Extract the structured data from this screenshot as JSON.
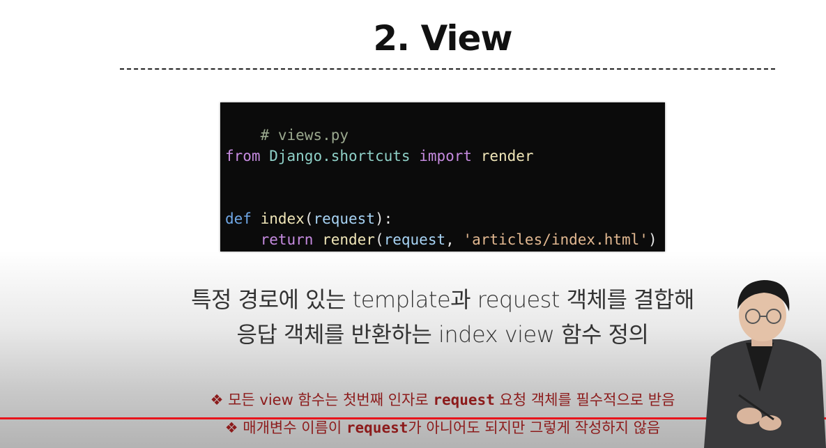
{
  "slide": {
    "title": "2. View",
    "code": {
      "comment": "# views.py",
      "line2": {
        "kw_from": "from",
        "module": "Django.shortcuts",
        "kw_import": "import",
        "name": "render"
      },
      "line5": {
        "kw_def": "def",
        "fn": "index",
        "open": "(",
        "param": "request",
        "close": "):"
      },
      "line6": {
        "kw_return": "return",
        "fn": "render",
        "open": "(",
        "param": "request",
        "sep": ", ",
        "str": "'articles/index.html'",
        "close": ")"
      }
    },
    "description": {
      "line1": "특정 경로에 있는 template과 request 객체를 결합해",
      "line2": "응답 객체를 반환하는 index view 함수 정의"
    },
    "notes": [
      {
        "bullet": "❖",
        "before": " 모든 view 함수는 첫번째 인자로 ",
        "code": "request",
        "after": "  요청 객체를 필수적으로 받음"
      },
      {
        "bullet": "❖",
        "before": " 매개변수 이름이 ",
        "code": "request",
        "after": "가 아니어도 되지만 그렇게 작성하지 않음"
      }
    ]
  },
  "colors": {
    "code_bg": "#0b0b0b",
    "note_text": "#8c1b1b",
    "progress_line": "#e8141b"
  }
}
